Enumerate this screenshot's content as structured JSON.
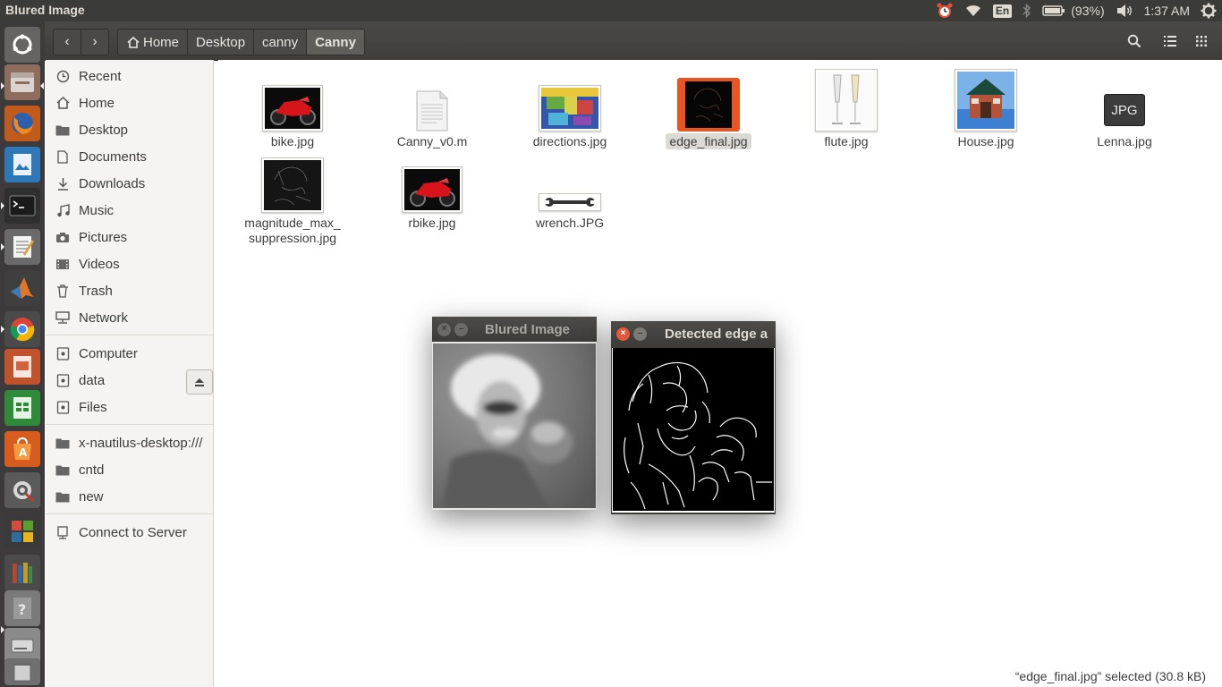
{
  "top_panel": {
    "title": "Blured Image",
    "keyboard": "En",
    "battery": "(93%)",
    "clock": "1:37 AM"
  },
  "launcher": {
    "items": [
      "dash-home",
      "files",
      "firefox",
      "image-viewer",
      "terminal",
      "text-editor",
      "matlab",
      "chrome",
      "impress",
      "calc",
      "software-center",
      "system-settings",
      "workspaces",
      "books",
      "help",
      "drive",
      "trash"
    ]
  },
  "headerbar": {
    "breadcrumbs": [
      "Home",
      "Desktop",
      "canny",
      "Canny"
    ]
  },
  "sidebar": {
    "places": [
      "Recent",
      "Home",
      "Desktop",
      "Documents",
      "Downloads",
      "Music",
      "Pictures",
      "Videos",
      "Trash",
      "Network"
    ],
    "devices": [
      "Computer",
      "data",
      "Files"
    ],
    "bookmarks": [
      "x-nautilus-desktop:///",
      "cntd",
      "new"
    ],
    "connect": "Connect to Server"
  },
  "files": [
    {
      "name": "bike.jpg"
    },
    {
      "name": "Canny_v0.m"
    },
    {
      "name": "directions.jpg"
    },
    {
      "name": "edge_final.jpg"
    },
    {
      "name": "flute.jpg"
    },
    {
      "name": "House.jpg"
    },
    {
      "name": "Lenna.jpg",
      "thumb_text": "JPG"
    },
    {
      "name": "magnitude_max_suppression.jpg",
      "line1": "magnitude_max_",
      "line2": "suppression.jpg"
    },
    {
      "name": "rbike.jpg"
    },
    {
      "name": "wrench.JPG"
    }
  ],
  "status_bar": "“edge_final.jpg” selected  (30.8 kB)",
  "windows": {
    "blurred": {
      "title": "Blured Image"
    },
    "edges": {
      "title": "Detected edge a"
    }
  },
  "colors": {
    "panel": "#3b3b37",
    "launcher": "#3d3a3b",
    "selection_orange": "#e95420",
    "sidebar": "#f5f4f2"
  }
}
